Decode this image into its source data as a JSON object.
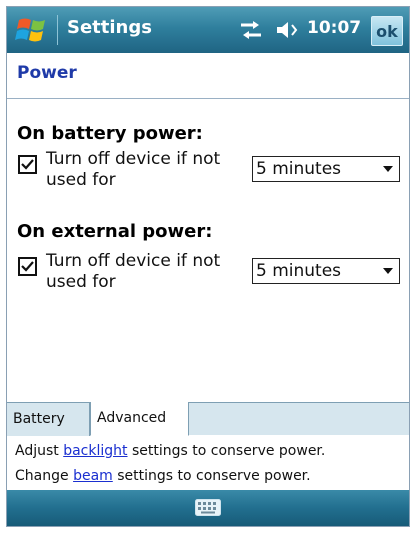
{
  "titlebar": {
    "title": "Settings",
    "time": "10:07",
    "ok_label": "ok",
    "icons": [
      "windows-start-icon",
      "network-icon",
      "volume-icon"
    ]
  },
  "page": {
    "title": "Power"
  },
  "battery": {
    "heading": "On battery power:",
    "checkbox_checked": true,
    "label": "Turn off device if not used for",
    "dropdown_value": "5 minutes"
  },
  "external": {
    "heading": "On external power:",
    "checkbox_checked": true,
    "label": "Turn off device if not used for",
    "dropdown_value": "5 minutes"
  },
  "tabs": [
    {
      "label": "Battery",
      "active": false
    },
    {
      "label": "Advanced",
      "active": true
    }
  ],
  "help": {
    "line1_prefix": "Adjust ",
    "line1_link": "backlight",
    "line1_suffix": " settings to conserve power.",
    "line2_prefix": "Change ",
    "line2_link": "beam",
    "line2_suffix": " settings to conserve power."
  },
  "bottombar": {
    "icon": "keyboard-icon"
  },
  "colors": {
    "title_bar": "#2f7f9d",
    "page_title": "#1f3aa8",
    "link": "#1a2fd0",
    "tab_bar": "#d6e6ee"
  }
}
